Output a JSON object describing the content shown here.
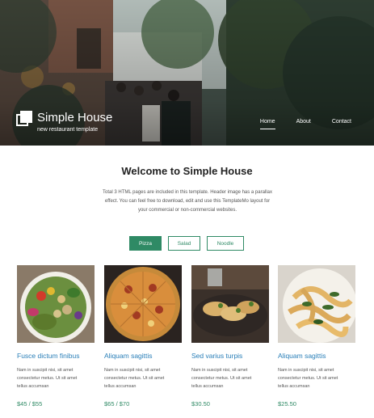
{
  "header": {
    "site_title": "Simple House",
    "tagline": "new restaurant template",
    "nav": [
      {
        "label": "Home",
        "active": true
      },
      {
        "label": "About",
        "active": false
      },
      {
        "label": "Contact",
        "active": false
      }
    ]
  },
  "welcome": {
    "title": "Welcome to Simple House",
    "line1": "Total 3 HTML pages are included in this template. Header image has a parallax",
    "line2": "effect. You can feel free to download, edit and use this TemplateMo layout for",
    "line3": "your commercial or non-commercial websites."
  },
  "tabs": [
    {
      "label": "Pizza",
      "active": true
    },
    {
      "label": "Salad",
      "active": false
    },
    {
      "label": "Noodle",
      "active": false
    }
  ],
  "cards": [
    {
      "name": "Fusce dictum finibus",
      "desc1": "Nam in suscipit nisi, sit amet",
      "desc2": "consectetur metus. Ut sit amet",
      "desc3": "tellus accumsan",
      "price": "$45 / $55"
    },
    {
      "name": "Aliquam sagittis",
      "desc1": "Nam in suscipit nisi, sit amet",
      "desc2": "consectetur metus. Ut sit amet",
      "desc3": "tellus accumsan",
      "price": "$65 / $70"
    },
    {
      "name": "Sed varius turpis",
      "desc1": "Nam in suscipit nisi, sit amet",
      "desc2": "consectetur metus. Ut sit amet",
      "desc3": "tellus accumsan",
      "price": "$30.50"
    },
    {
      "name": "Aliquam sagittis",
      "desc1": "Nam in suscipit nisi, sit amet",
      "desc2": "consectetur metus. Ut sit amet",
      "desc3": "tellus accumsan",
      "price": "$25.50"
    }
  ],
  "colors": {
    "accent": "#2f8a65",
    "card_title": "#2a7fb8"
  }
}
